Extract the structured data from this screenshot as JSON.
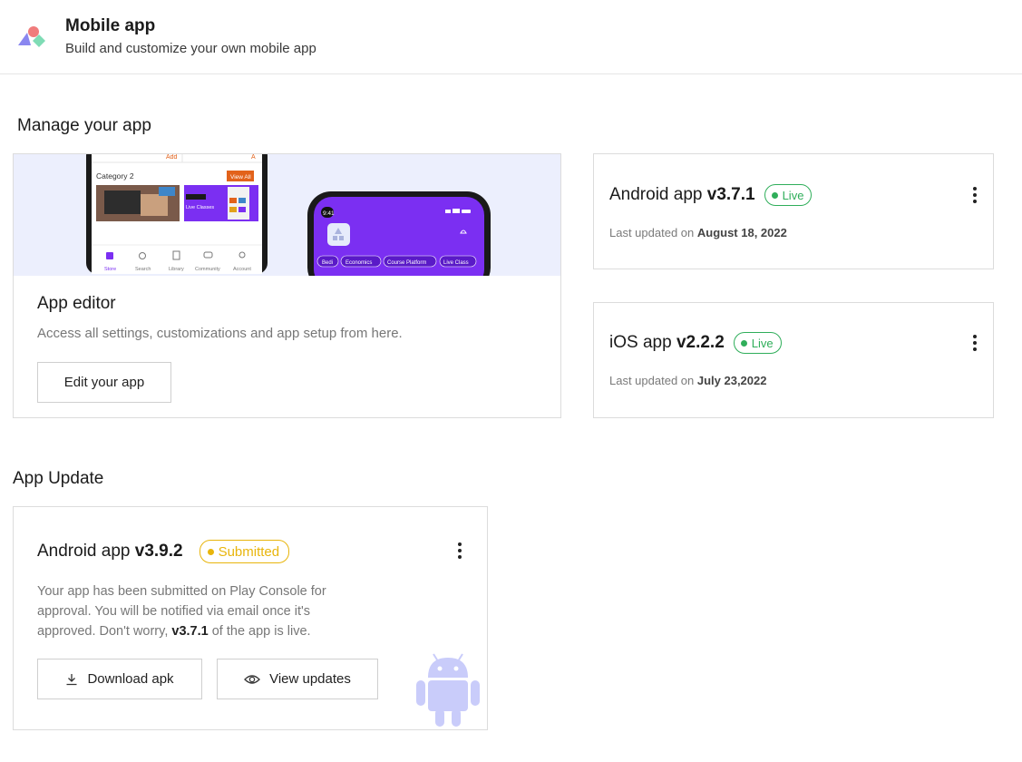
{
  "header": {
    "title": "Mobile app",
    "subtitle": "Build and customize your own mobile app"
  },
  "manage": {
    "section_title": "Manage your app",
    "editor": {
      "title": "App editor",
      "description": "Access all settings, customizations and app setup from here.",
      "button": "Edit your app",
      "preview": {
        "left_phone": {
          "add_label_1": "Add",
          "add_label_2": "A",
          "category": "Category 2",
          "view_all": "View All",
          "tile_text": "Live Classes",
          "nav": [
            "Store",
            "Search",
            "Library",
            "Community",
            "Account"
          ]
        },
        "right_phone": {
          "time": "9:41",
          "chips": [
            "Bedi",
            "Economics",
            "Course Platform",
            "Live Class"
          ]
        }
      }
    },
    "releases": [
      {
        "name": "Android app ",
        "version": "v3.7.1",
        "status": "Live",
        "date_prefix": "Last updated on ",
        "date": "August 18, 2022"
      },
      {
        "name": "iOS app ",
        "version": "v2.2.2",
        "status": "Live",
        "date_prefix": "Last updated on ",
        "date": "July 23,2022"
      }
    ]
  },
  "update": {
    "section_title": "App Update",
    "name": "Android app ",
    "version": "v3.9.2",
    "status": "Submitted",
    "desc_part1": "Your app has been submitted on Play Console for approval. You will be notified via email once it's approved. Don't worry, ",
    "desc_version": "v3.7.1",
    "desc_part2": " of the app is live.",
    "download_button": "Download apk",
    "view_button": "View updates"
  },
  "colors": {
    "live": "#2fae5a",
    "submitted": "#e8b50c",
    "brand_purple": "#7b2ff2",
    "android_art": "#c9ccfa",
    "preview_bg": "#eceffd"
  }
}
